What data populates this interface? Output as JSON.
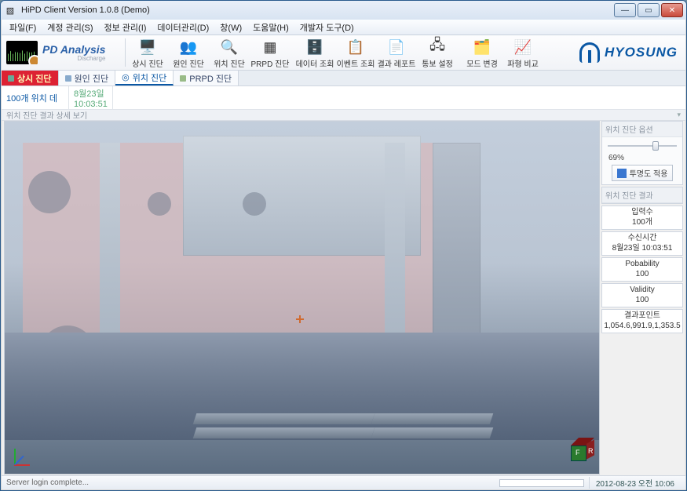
{
  "window": {
    "title": "HiPD Client Version 1.0.8 (Demo)"
  },
  "menu": {
    "file": "파일(F)",
    "schedule": "계정 관리(S)",
    "info": "정보 관리(I)",
    "data": "데이터관리(D)",
    "window": "창(W)",
    "help": "도움말(H)",
    "dev": "개발자 도구(D)"
  },
  "brand": {
    "title": "PD Analysis",
    "sub": "Discharge"
  },
  "tools": {
    "t0": "상시 진단",
    "t1": "원인 진단",
    "t2": "위치 진단",
    "t3": "PRPD 진단",
    "t4": "데이터 조회",
    "t5": "이벤트 조회",
    "t6": "결과 레포트",
    "t7": "통보 설정",
    "t8": "모드 변경",
    "t9": "파형 비교"
  },
  "logo": {
    "name": "HYOSUNG"
  },
  "subtabs": {
    "alert": "상시 진단",
    "cause": "원인 진단",
    "loc": "위치 진단",
    "prpd": "PRPD 진단"
  },
  "infostrip": {
    "count": "100개 위치 데",
    "date": "8월23일",
    "time": "10:03:51"
  },
  "viewhdr": {
    "title": "위치 진단 결과 상세 보기",
    "drop": "▾"
  },
  "side": {
    "opt_title": "위치 진단 옵션",
    "transparency_pct": "69%",
    "apply": "투명도 적용",
    "res_title": "위치 진단 결과",
    "in_k": "입력수",
    "in_v": "100개",
    "rx_k": "수신시간",
    "rx_v": "8월23일 10:03:51",
    "pb_k": "Pobability",
    "pb_v": "100",
    "vl_k": "Validity",
    "vl_v": "100",
    "pt_k": "결과포인트",
    "pt_v": "1,054.6,991.9,1,353.5"
  },
  "gizmo": {
    "front": "F",
    "right": "R"
  },
  "status": {
    "msg": "Server login complete...",
    "ts": "2012-08-23 오전 10:06"
  }
}
